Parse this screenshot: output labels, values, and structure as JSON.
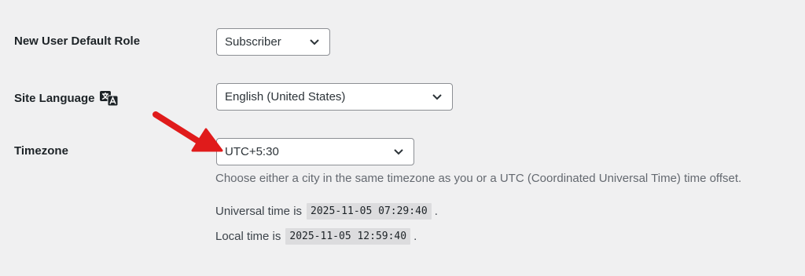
{
  "settings": {
    "default_role": {
      "label": "New User Default Role",
      "value": "Subscriber"
    },
    "site_language": {
      "label": "Site Language",
      "value": "English (United States)",
      "icon": "translation-icon"
    },
    "timezone": {
      "label": "Timezone",
      "value": "UTC+5:30",
      "description": "Choose either a city in the same timezone as you or a UTC (Coordinated Universal Time) time offset.",
      "universal_prefix": "Universal time is",
      "universal_time": "2025-11-05 07:29:40",
      "universal_suffix": ".",
      "local_prefix": "Local time is",
      "local_time": "2025-11-05 12:59:40",
      "local_suffix": "."
    }
  },
  "annotation": {
    "arrow_color": "#e01b1b",
    "arrow_icon": "red-arrow-icon"
  },
  "colors": {
    "background": "#f0f0f1",
    "label_text": "#1d2327",
    "description_text": "#646970",
    "code_background": "#dcdcde"
  }
}
